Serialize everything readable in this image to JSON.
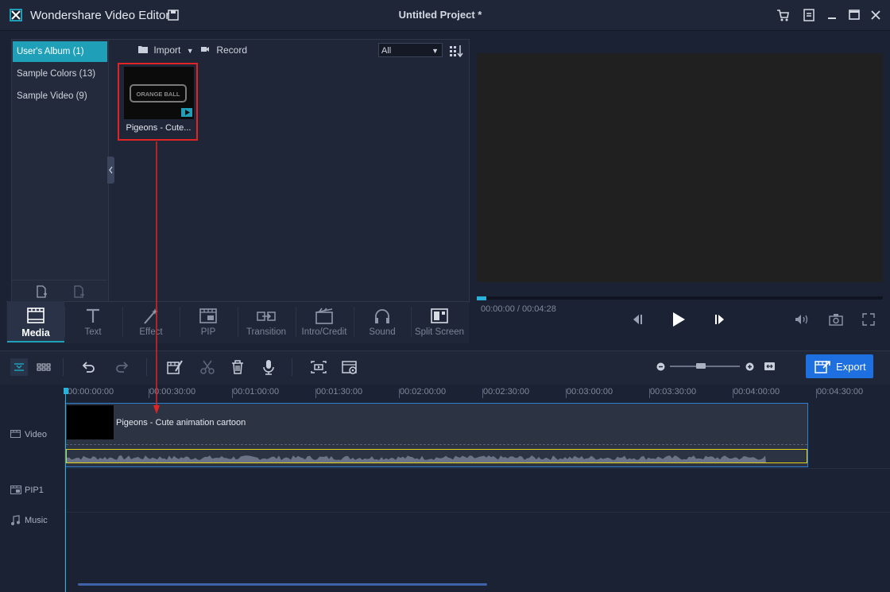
{
  "window": {
    "app_title": "Wondershare Video Editor",
    "project_title": "Untitled Project *",
    "icons": [
      "app-logo-icon",
      "save-icon",
      "cart-icon",
      "menu-icon",
      "minimize-icon",
      "maximize-icon",
      "close-icon"
    ]
  },
  "albums": [
    {
      "label": "User's Album (1)",
      "active": true
    },
    {
      "label": "Sample Colors (13)",
      "active": false
    },
    {
      "label": "Sample Video (9)",
      "active": false
    }
  ],
  "media_toolbar": {
    "import_label": "Import",
    "record_label": "Record",
    "filter_value": "All"
  },
  "media_items": [
    {
      "label": "Pigeons - Cute...",
      "thumb_text": "ORANGE BALL"
    }
  ],
  "tabs": [
    {
      "label": "Media",
      "active": true,
      "icon": "media-icon"
    },
    {
      "label": "Text",
      "active": false,
      "icon": "text-icon"
    },
    {
      "label": "Effect",
      "active": false,
      "icon": "effect-icon"
    },
    {
      "label": "PIP",
      "active": false,
      "icon": "pip-icon"
    },
    {
      "label": "Transition",
      "active": false,
      "icon": "transition-icon"
    },
    {
      "label": "Intro/Credit",
      "active": false,
      "icon": "intro-credit-icon"
    },
    {
      "label": "Sound",
      "active": false,
      "icon": "sound-icon"
    },
    {
      "label": "Split Screen",
      "active": false,
      "icon": "split-screen-icon"
    }
  ],
  "preview": {
    "time": "00:00:00 / 00:04:28",
    "progress": 0.0,
    "controls": [
      "prev-frame-icon",
      "play-icon",
      "next-frame-icon",
      "volume-icon",
      "snapshot-icon",
      "fullscreen-icon"
    ]
  },
  "timeline_toolbar": {
    "export_label": "Export",
    "buttons": [
      "timeline-view-icon",
      "storyboard-view-icon",
      "undo-icon",
      "redo-icon",
      "edit-icon",
      "cut-icon",
      "delete-icon",
      "voiceover-icon",
      "crop-icon",
      "settings-icon",
      "zoom-out-icon",
      "zoom-in-icon",
      "fit-icon"
    ]
  },
  "ruler": [
    "00:00:00:00",
    "00:00:30:00",
    "00:01:00:00",
    "00:01:30:00",
    "00:02:00:00",
    "00:02:30:00",
    "00:03:00:00",
    "00:03:30:00",
    "00:04:00:00",
    "00:04:30:00"
  ],
  "tracks": {
    "video_label": "Video",
    "pip_label": "PIP1",
    "music_label": "Music",
    "clip_label": "Pigeons - Cute animation cartoon"
  }
}
